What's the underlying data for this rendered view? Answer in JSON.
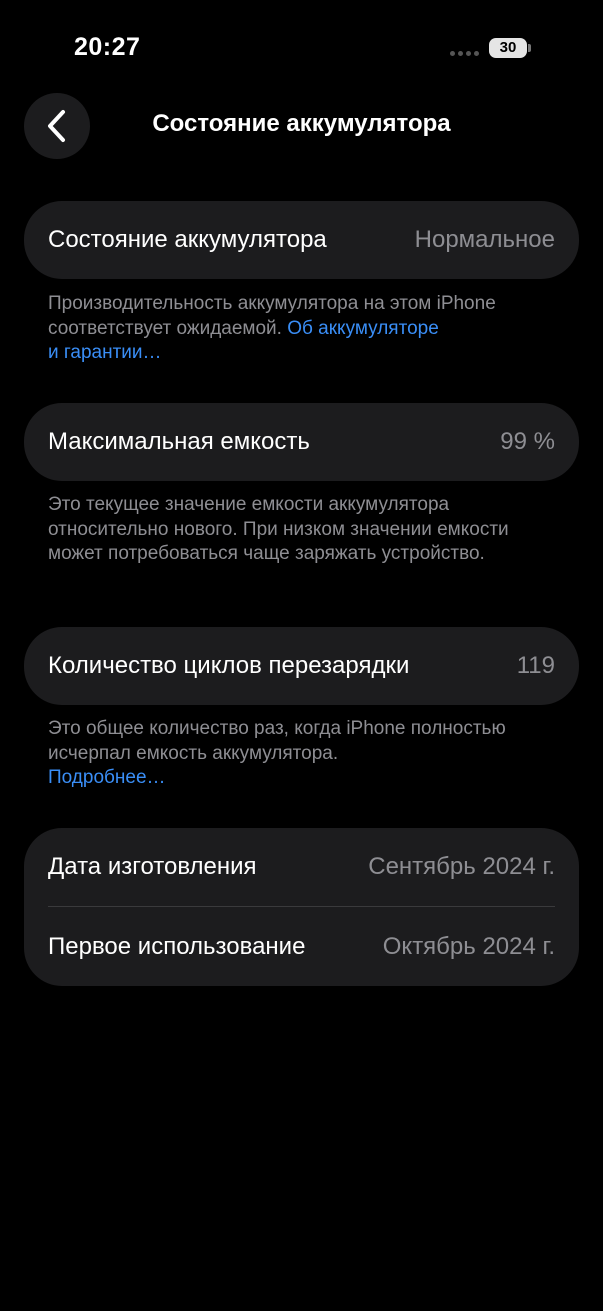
{
  "status_bar": {
    "time": "20:27",
    "battery_level": "30"
  },
  "header": {
    "title": "Состояние аккумулятора"
  },
  "battery_health": {
    "label": "Состояние аккумулятора",
    "value": "Нормальное",
    "note_text": "Производительность аккумулятора на этом iPhone соответствует ожидаемой.",
    "note_link_line1": "Об аккумуляторе",
    "note_link_line2": "и гарантии…"
  },
  "max_capacity": {
    "label": "Максимальная емкость",
    "value": "99 %",
    "note_text": "Это текущее значение емкости аккумулятора относительно нового. При низком значении емкости может потребоваться чаще заряжать устройство."
  },
  "cycle_count": {
    "label": "Количество циклов перезарядки",
    "value": "119",
    "note_text": "Это общее количество раз, когда iPhone полностью исчерпал емкость аккумулятора.",
    "note_link": "Подробнее…"
  },
  "dates": {
    "manufacture_label": "Дата изготовления",
    "manufacture_value": "Сентябрь 2024 г.",
    "first_use_label": "Первое использование",
    "first_use_value": "Октябрь 2024 г."
  }
}
